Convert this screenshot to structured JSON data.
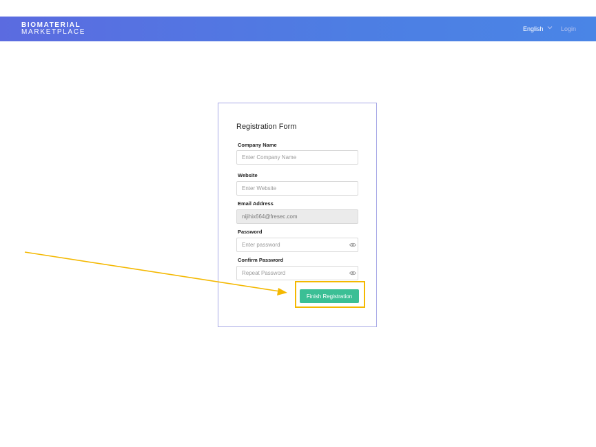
{
  "header": {
    "logo_line1": "BIOMATERIAL",
    "logo_line2": "MARKETPLACE",
    "language": "English",
    "login_label": "Login"
  },
  "form": {
    "title": "Registration Form",
    "company": {
      "label": "Company Name",
      "placeholder": "Enter Company Name"
    },
    "website": {
      "label": "Website",
      "placeholder": "Enter Website"
    },
    "email": {
      "label": "Email Address",
      "value": "nijihix664@fresec.com"
    },
    "password": {
      "label": "Password",
      "placeholder": "Enter password"
    },
    "confirm": {
      "label": "Confirm Password",
      "placeholder": "Repeat Password"
    },
    "submit_label": "Finish Registration"
  },
  "colors": {
    "header_gradient_start": "#5b6be0",
    "header_gradient_end": "#4a85e6",
    "button": "#3bbf95",
    "annotation": "#f4b800",
    "card_border": "#a7a8e6"
  },
  "icons": [
    "chevron-down-icon",
    "eye-icon",
    "arrow-annotation"
  ]
}
